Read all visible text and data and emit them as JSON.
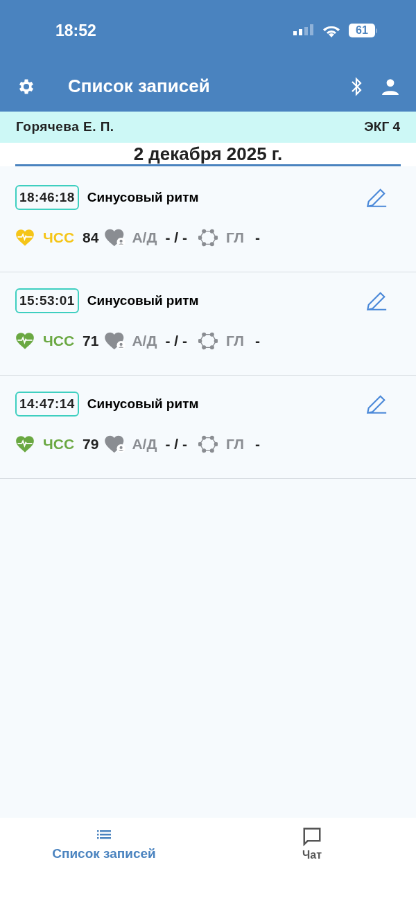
{
  "status_bar": {
    "time": "18:52",
    "battery": "61"
  },
  "toolbar": {
    "title": "Список записей"
  },
  "patient_bar": {
    "name": "Горячева Е. П.",
    "device": "ЭКГ 4"
  },
  "date": "2 декабря 2025 г.",
  "records": [
    {
      "time": "18:46:18",
      "rhythm": "Синусовый ритм",
      "hr_label": "ЧСС",
      "hr": "84",
      "color": "#f5c518",
      "bp_label": "А/Д",
      "bp": "- / -",
      "gl_label": "ГЛ",
      "gl": "-"
    },
    {
      "time": "15:53:01",
      "rhythm": "Синусовый ритм",
      "hr_label": "ЧСС",
      "hr": "71",
      "color": "#6aa842",
      "bp_label": "А/Д",
      "bp": "- / -",
      "gl_label": "ГЛ",
      "gl": "-"
    },
    {
      "time": "14:47:14",
      "rhythm": "Синусовый ритм",
      "hr_label": "ЧСС",
      "hr": "79",
      "color": "#6aa842",
      "bp_label": "А/Д",
      "bp": "- / -",
      "gl_label": "ГЛ",
      "gl": "-"
    }
  ],
  "tabs": [
    {
      "label": "Список записей",
      "kind": "list",
      "selected": true
    },
    {
      "label": "Чат",
      "kind": "chat",
      "selected": false
    }
  ]
}
